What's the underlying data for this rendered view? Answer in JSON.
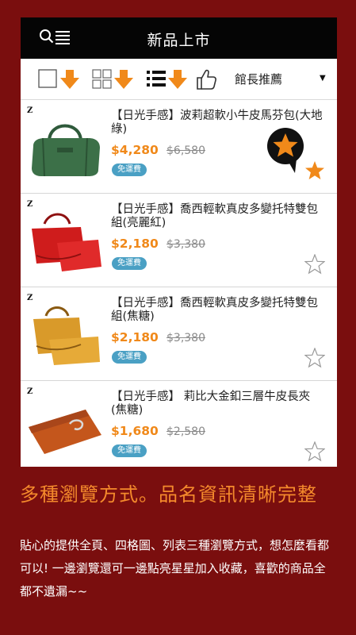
{
  "header": {
    "title": "新品上市"
  },
  "toolbar": {
    "sort_label": "館長推薦"
  },
  "products": [
    {
      "brand": "Z",
      "name": "【日光手感】波莉超軟小牛皮馬芬包(大地綠)",
      "price": "$4,280",
      "original_price": "$6,580",
      "shipping": "免運費",
      "favorited": true
    },
    {
      "brand": "Z",
      "name": "【日光手感】喬西輕軟真皮多變托特雙包組(亮麗紅)",
      "price": "$2,180",
      "original_price": "$3,380",
      "shipping": "免運費",
      "favorited": false
    },
    {
      "brand": "Z",
      "name": "【日光手感】喬西輕軟真皮多變托特雙包組(焦糖)",
      "price": "$2,180",
      "original_price": "$3,380",
      "shipping": "免運費",
      "favorited": false
    },
    {
      "brand": "Z",
      "name": "【日光手感】 莉比大金釦三層牛皮長夾(焦糖)",
      "price": "$1,680",
      "original_price": "$2,580",
      "shipping": "免運費",
      "favorited": false
    }
  ],
  "promo": {
    "headline": "多種瀏覽方式。品名資訊清晰完整",
    "body": "貼心的提供全頁、四格圖、列表三種瀏覽方式，想怎麼看都可以! 一邊瀏覽還可一邊點亮星星加入收藏，喜歡的商品全都不遺漏~~"
  },
  "colors": {
    "accent": "#f0891a",
    "promo_bg": "#7a0e0e",
    "shipping_badge": "#4aa0c4"
  },
  "icons": [
    "search-icon",
    "menu-icon",
    "single-view-icon",
    "grid-view-icon",
    "list-view-icon",
    "thumbs-up-icon",
    "star-icon",
    "chevron-down-icon",
    "down-arrow-icon"
  ]
}
